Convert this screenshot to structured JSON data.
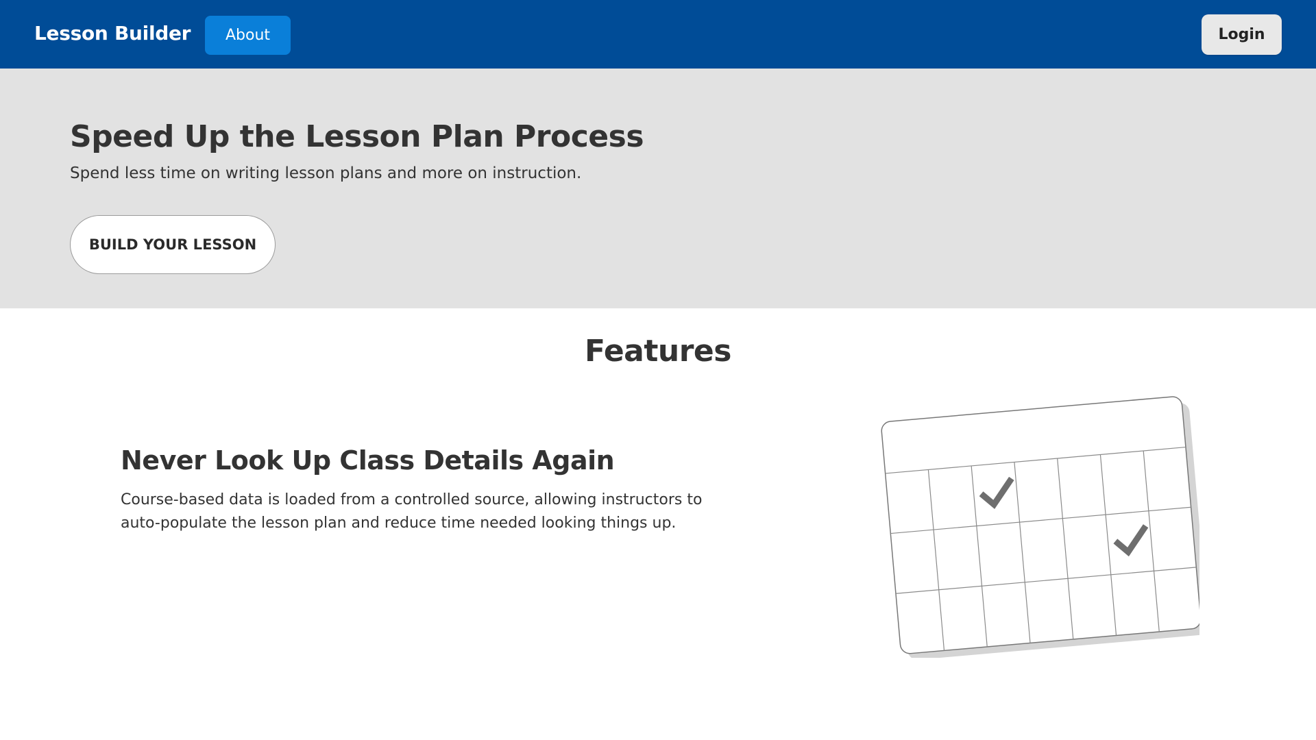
{
  "navbar": {
    "brand": "Lesson Builder",
    "about_label": "About",
    "login_label": "Login",
    "background_color": "#004c97",
    "about_color": "#0a7fd9"
  },
  "hero": {
    "title": "Speed Up the Lesson Plan Process",
    "subtitle": "Spend less time on writing lesson plans and more on instruction.",
    "cta_label": "BUILD YOUR LESSON",
    "background_color": "#e2e2e2"
  },
  "features": {
    "heading": "Features",
    "items": [
      {
        "title": "Never Look Up Class Details Again",
        "description": "Course-based data is loaded from a controlled source, allowing instructors to auto-populate the lesson plan and reduce time needed looking things up.",
        "illustration_icon": "calendar-checkmarks-icon"
      }
    ]
  }
}
